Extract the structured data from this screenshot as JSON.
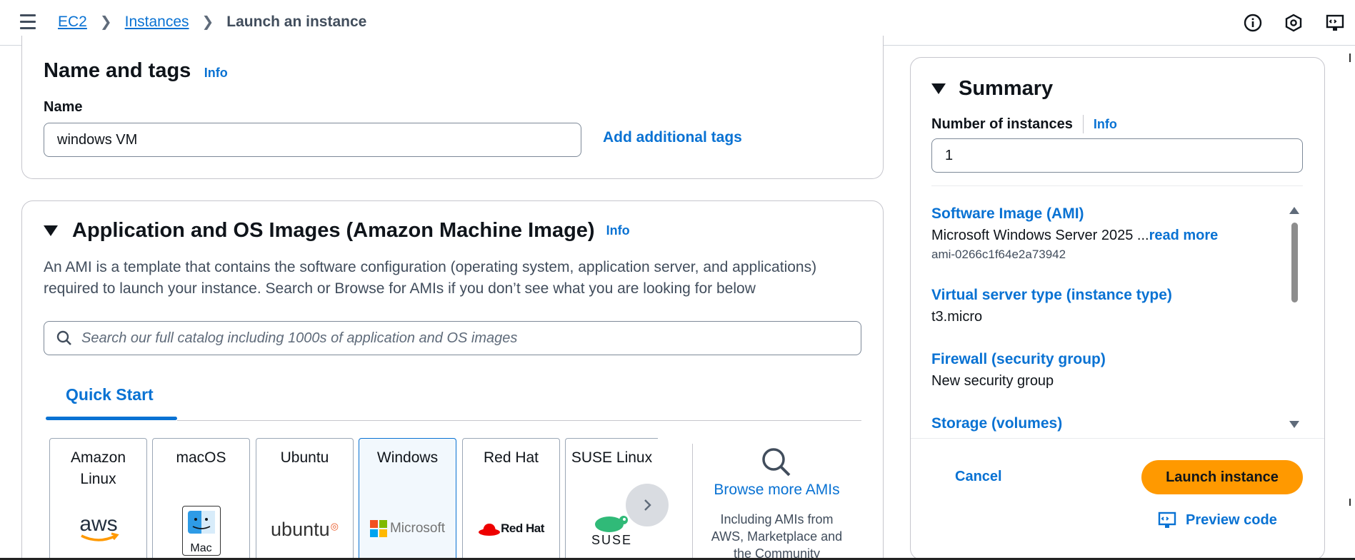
{
  "breadcrumbs": {
    "ec2": "EC2",
    "instances": "Instances",
    "current": "Launch an instance"
  },
  "top_icons": [
    "info-circle-icon",
    "settings-hex-icon",
    "preview-code-icon"
  ],
  "name_tags": {
    "title": "Name and tags",
    "info": "Info",
    "name_label": "Name",
    "name_value": "windows VM",
    "add_tags": "Add additional tags"
  },
  "ami": {
    "title": "Application and OS Images (Amazon Machine Image)",
    "info": "Info",
    "description_line1": "An AMI is a template that contains the software configuration (operating system, application server, and applications)",
    "description_line2": "required to launch your instance. Search or Browse for AMIs if you don’t see what you are looking for below",
    "search_placeholder": "Search our full catalog including 1000s of application and OS images",
    "tab_quick_start": "Quick Start",
    "tiles": [
      {
        "name_line1": "Amazon",
        "name_line2": "Linux",
        "logo": "aws"
      },
      {
        "name_line1": "macOS",
        "logo": "Mac"
      },
      {
        "name_line1": "Ubuntu",
        "logo": "ubuntu"
      },
      {
        "name_line1": "Windows",
        "logo": "Microsoft",
        "selected": true
      },
      {
        "name_line1": "Red Hat",
        "logo": "Red Hat"
      },
      {
        "name_line1": "SUSE Linux",
        "logo": "SUSE"
      }
    ],
    "browse_more": "Browse more AMIs",
    "browse_desc_line1": "Including AMIs from",
    "browse_desc_line2": "AWS, Marketplace and",
    "browse_desc_line3": "the Community"
  },
  "summary": {
    "title": "Summary",
    "num_instances_label": "Number of instances",
    "info": "Info",
    "num_instances_value": "1",
    "software_image_label": "Software Image (AMI)",
    "software_image_value": "Microsoft Windows Server 2025 ...",
    "read_more": "read more",
    "ami_id": "ami-0266c1f64e2a73942",
    "instance_type_label": "Virtual server type (instance type)",
    "instance_type_value": "t3.micro",
    "firewall_label": "Firewall (security group)",
    "firewall_value": "New security group",
    "storage_label": "Storage (volumes)",
    "cancel": "Cancel",
    "launch": "Launch instance",
    "preview_code": "Preview code"
  },
  "colors": {
    "link": "#0972d3",
    "primary_button": "#ff9900",
    "text": "#0f141a",
    "border": "#c6c6cd"
  }
}
